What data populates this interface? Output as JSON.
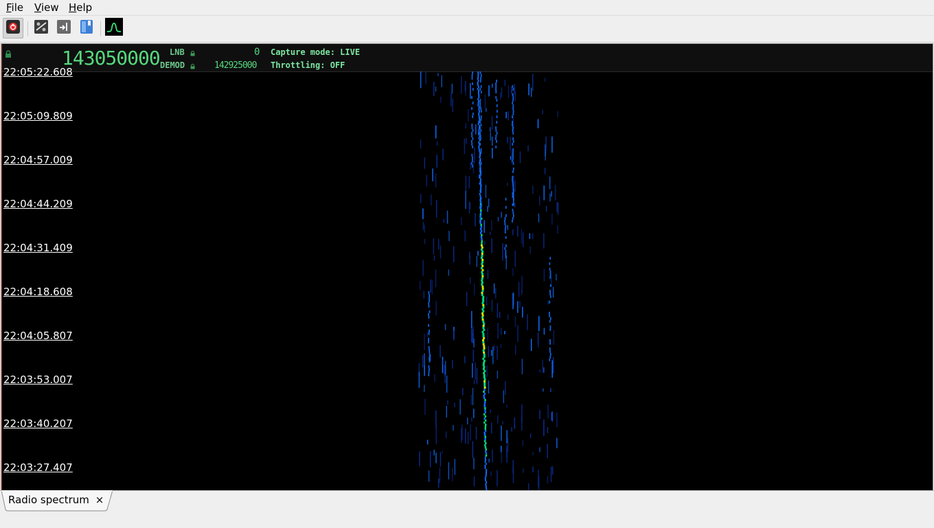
{
  "menu": {
    "items": [
      {
        "label": "File"
      },
      {
        "label": "View"
      },
      {
        "label": "Help"
      }
    ]
  },
  "toolbar": {
    "buttons": [
      {
        "icon": "power-icon",
        "pressed": true
      },
      {
        "icon": "settings-sliders-icon"
      },
      {
        "icon": "arrow-in-icon"
      },
      {
        "icon": "bookmarks-book-icon"
      },
      {
        "icon": "spectrum-panel-icon"
      }
    ]
  },
  "info_panel": {
    "frequency": "143050000",
    "lnb_label": "LNB",
    "lnb_value": "0",
    "demod_label": "DEMOD",
    "demod_value": "142925000",
    "capture_mode": "Capture mode: LIVE",
    "throttling": "Throttling: OFF"
  },
  "waterfall": {
    "time_labels": [
      "22:05:22.608",
      "22:05:09.809",
      "22:04:57.009",
      "22:04:44.209",
      "22:04:31.409",
      "22:04:18.608",
      "22:04:05.807",
      "22:03:53.007",
      "22:03:40.207",
      "22:03:27.407"
    ],
    "colors": {
      "strong": "#d6f000",
      "mid": "#00e080",
      "low": "#1070ff",
      "faint": "#0a2a8a"
    }
  },
  "tabs": [
    {
      "label": "Radio spectrum",
      "close": "×"
    }
  ]
}
